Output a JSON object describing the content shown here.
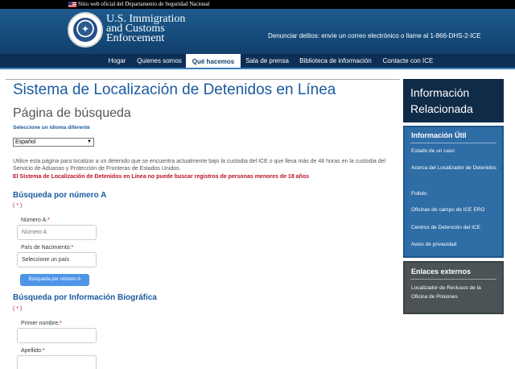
{
  "gov_banner": {
    "text": "Sitio web oficial del Departamento de Seguridad Nacional"
  },
  "header": {
    "agency_line1": "U.S. Immigration",
    "agency_line2": "and Customs",
    "agency_line3": "Enforcement",
    "hotline": "Denunciar delitos: envíe un correo electrónico o llame al 1-866-DHS-2-ICE"
  },
  "nav": {
    "items": [
      "Hogar",
      "Quienes somos",
      "Qué hacemos",
      "Sala de prensa",
      "Biblioteca de información",
      "Contacte con ICE"
    ],
    "active": "Qué hacemos"
  },
  "main": {
    "title": "Sistema de Localización de Detenidos en Línea",
    "subtitle": "Página de búsqueda",
    "language_label": "Seleccione un idioma diferente",
    "language_value": "Español",
    "intro": "Utilice esta página para localizar a un detenido que se encuentra actualmente bajo la custodia del ICE o que lleva más de 48 horas en la custodia del Servicio de Aduanas y Protección de Fronteras de Estados Unidos.",
    "warning": "El Sistema de Localización de Detenidos en Línea no puede buscar registros de personas menores de 18 años",
    "search_a": {
      "heading": "Búsqueda por número A",
      "required_note": "( * )",
      "number_label": "Número A:",
      "number_placeholder": "Número A",
      "country_label": "País de Nacimiento:",
      "country_value": "Seleccione un país",
      "button": "Búsqueda por número A"
    },
    "search_bio": {
      "heading": "Búsqueda por Información Biográfica",
      "required_note": "( * )",
      "first_name_label": "Primer nombre:",
      "last_name_label": "Apellido:"
    },
    "required_mark": "*"
  },
  "sidebar": {
    "top_title_line1": "Información",
    "top_title_line2": "Relacionada",
    "useful": {
      "heading": "Información Útil",
      "links": [
        "Estado de un caso",
        "Acerca del Localizador de Detenidos",
        "Folleto",
        "Oficinas de campo de ICE ERO",
        "Centros de Detención del ICE",
        "Aviso de privacidad"
      ]
    },
    "external": {
      "heading": "Enlaces externos",
      "links": [
        "Localizador de Reclusos de la Oficina de Prisiones"
      ]
    }
  },
  "colors": {
    "accent": "#1a5aa0",
    "warning": "#c0102a",
    "nav_bg": "#0d2f56",
    "button": "#4d95e8"
  }
}
